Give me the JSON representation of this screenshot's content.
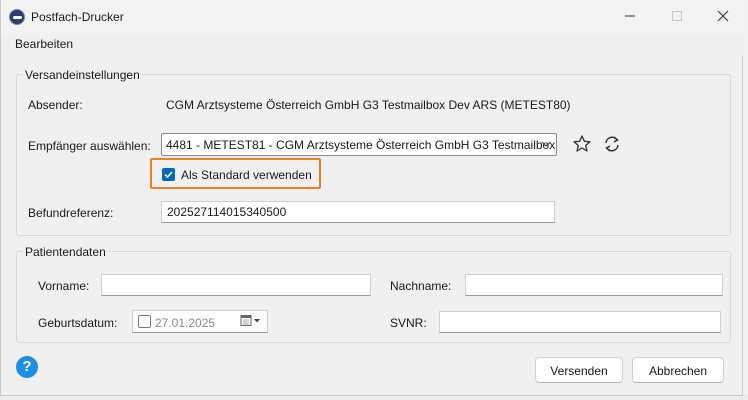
{
  "window": {
    "title": "Postfach-Drucker",
    "controls": {
      "minimize": "—",
      "maximize": "☐",
      "close": "✕"
    }
  },
  "menu": {
    "items": [
      "Bearbeiten"
    ]
  },
  "send_settings": {
    "legend": "Versandeinstellungen",
    "sender_label": "Absender:",
    "sender_value": "CGM Arztsysteme Österreich GmbH G3 Testmailbox Dev ARS (METEST80)",
    "recipient_label": "Empfänger auswählen:",
    "recipient_value": "4481 - METEST81 - CGM Arztsysteme Österreich GmbH G3 Testmailbox",
    "default_checkbox_label": "Als Standard verwenden",
    "default_checked": true,
    "reference_label": "Befundreferenz:",
    "reference_value": "202527114015340500"
  },
  "patient_data": {
    "legend": "Patientendaten",
    "firstname_label": "Vorname:",
    "firstname_value": "",
    "lastname_label": "Nachname:",
    "lastname_value": "",
    "birthdate_label": "Geburtsdatum:",
    "birthdate_value": "27.01.2025",
    "birthdate_enabled": false,
    "svnr_label": "SVNR:",
    "svnr_value": ""
  },
  "footer": {
    "help_label": "?",
    "send_label": "Versenden",
    "cancel_label": "Abbrechen"
  },
  "colors": {
    "accent": "#0067c0",
    "highlight": "#ec7f22",
    "help": "#1f8ee6"
  }
}
